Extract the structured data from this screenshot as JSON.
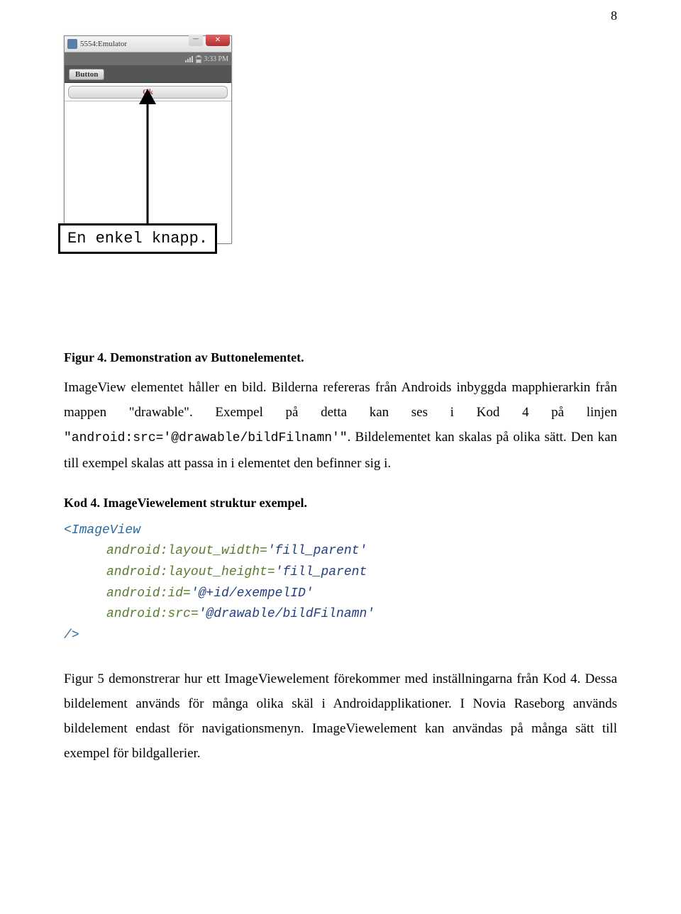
{
  "page_number": "8",
  "emulator": {
    "title": "5554:Emulator",
    "close_glyph": "✕",
    "min_glyph": "–",
    "status_time": "3:33 PM",
    "toolbar_button": "Button",
    "ok_button": "Ok"
  },
  "annotation": "En enkel knapp.",
  "figure4_caption": "Figur 4. Demonstration av Buttonelementet.",
  "para1_a": "ImageView elementet håller en bild. Bilderna refereras från Androids inbyggda mapphierarkin från mappen \"drawable\". Exempel på detta kan ses i Kod 4 på linjen ",
  "para1_mono": "\"android:src='@drawable/bildFilnamn'\"",
  "para1_b": ". Bildelementet kan skalas på olika sätt. Den kan till exempel skalas att passa in i elementet den befinner sig i.",
  "kod4_title": "Kod 4. ImageViewelement struktur exempel.",
  "code": {
    "open": "<ImageView",
    "l1a": "android:layout_width=",
    "l1v": "'fill_parent'",
    "l2a": "android:layout_height=",
    "l2v": "'fill_parent",
    "l3a": "android:id=",
    "l3v": "'@+id/exempelID'",
    "l4a": "android:src=",
    "l4v": "'@drawable/bildFilnamn'",
    "close": "/>"
  },
  "para2": "Figur 5 demonstrerar hur ett ImageViewelement förekommer med inställningarna från Kod 4. Dessa bildelement används för många olika skäl i Androidapplikationer. I Novia Raseborg används bildelement endast för navigationsmenyn. ImageViewelement kan användas på många sätt till exempel för bildgallerier."
}
